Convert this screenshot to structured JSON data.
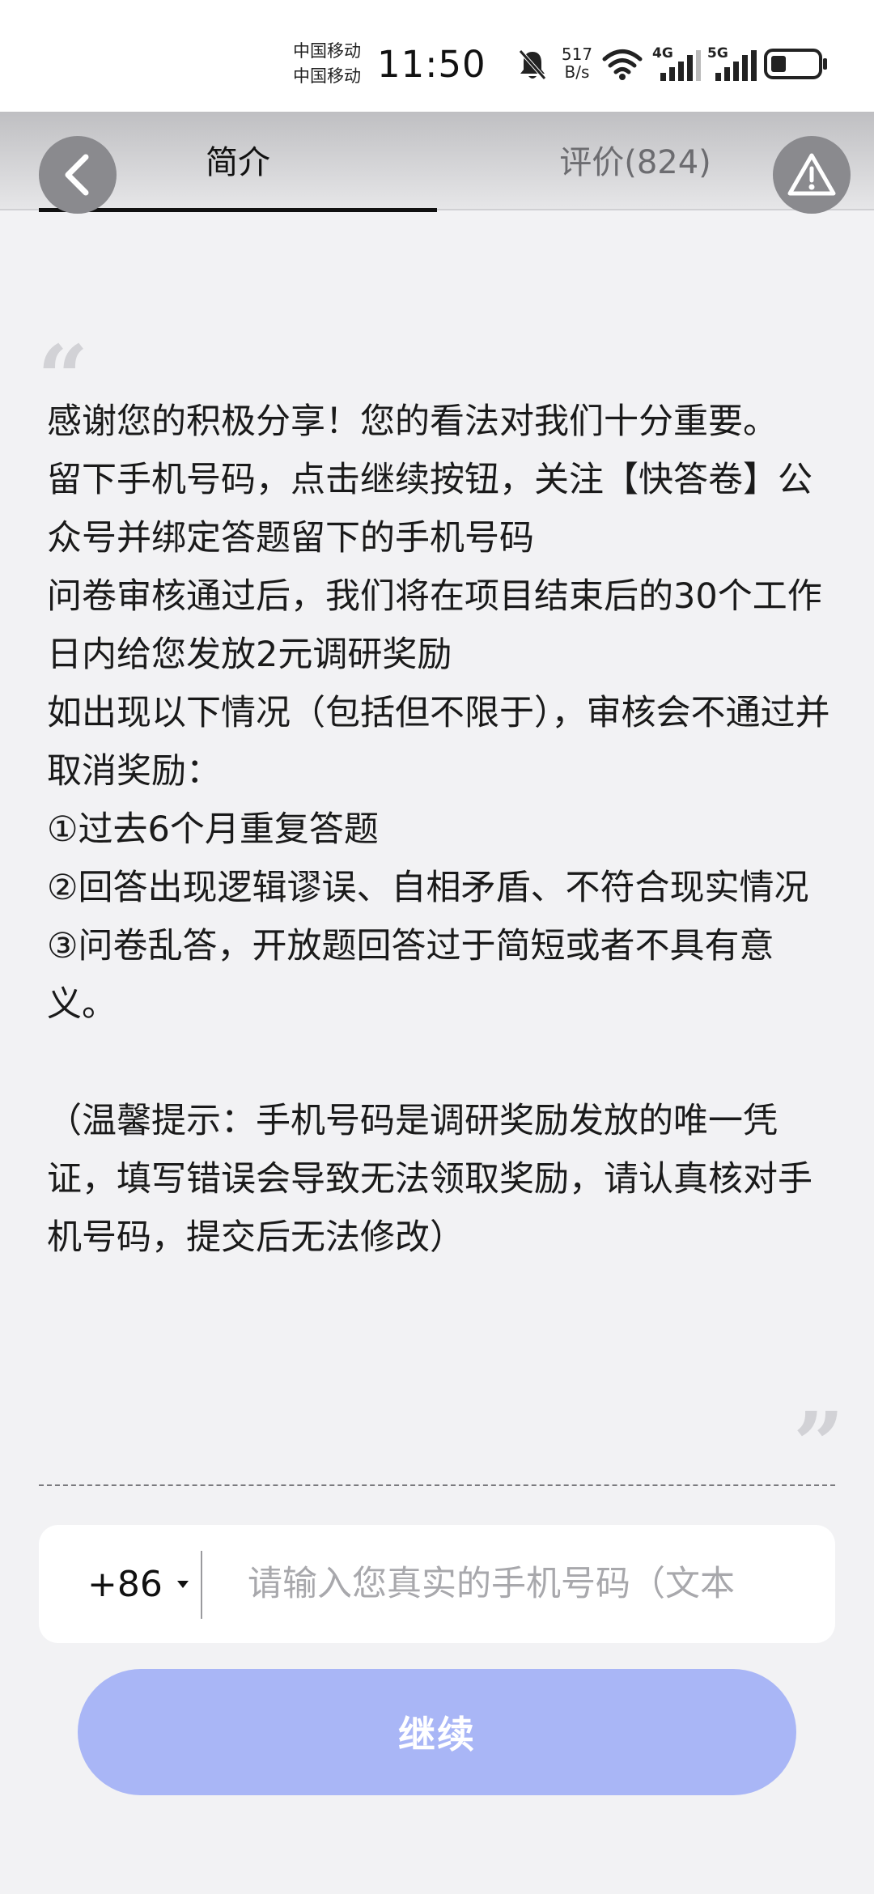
{
  "status_bar": {
    "carrier_1": "中国移动",
    "carrier_2": "中国移动",
    "time": "11:50",
    "net_speed_value": "517",
    "net_speed_unit": "B/s",
    "network_4g": "4G",
    "network_5g": "5G",
    "icons": [
      "bell-off-icon",
      "wifi-icon",
      "signal-4g-icon",
      "signal-5g-icon",
      "battery-icon"
    ]
  },
  "header": {
    "back_icon": "chevron-left-icon",
    "tab_intro_label": "简介",
    "tab_reviews_label": "评价(824)",
    "warning_icon": "warning-triangle-icon",
    "active_tab": "简介"
  },
  "intro": {
    "quote_open": "“",
    "quote_close": "”",
    "paragraphs": [
      "感谢您的积极分享！您的看法对我们十分重要。",
      "留下手机号码，点击继续按钮，关注【快答卷】公众号并绑定答题留下的手机号码",
      "问卷审核通过后，我们将在项目结束后的30个工作日内给您发放2元调研奖励",
      "如出现以下情况（包括但不限于），审核会不通过并取消奖励：",
      "①过去6个月重复答题",
      "②回答出现逻辑谬误、自相矛盾、不符合现实情况",
      "③问卷乱答，开放题回答过于简短或者不具有意义。",
      "（温馨提示：手机号码是调研奖励发放的唯一凭证，填写错误会导致无法领取奖励，请认真核对手机号码，提交后无法修改）"
    ]
  },
  "form": {
    "country_code": "+86",
    "phone_placeholder": "请输入您真实的手机号码（文本",
    "phone_value": "",
    "continue_label": "继续"
  },
  "colors": {
    "continue_button": "#a9b6f6",
    "header_bg": "#bfbfc2",
    "page_bg": "#f2f2f4",
    "round_button_bg": "#8a8a8e"
  }
}
